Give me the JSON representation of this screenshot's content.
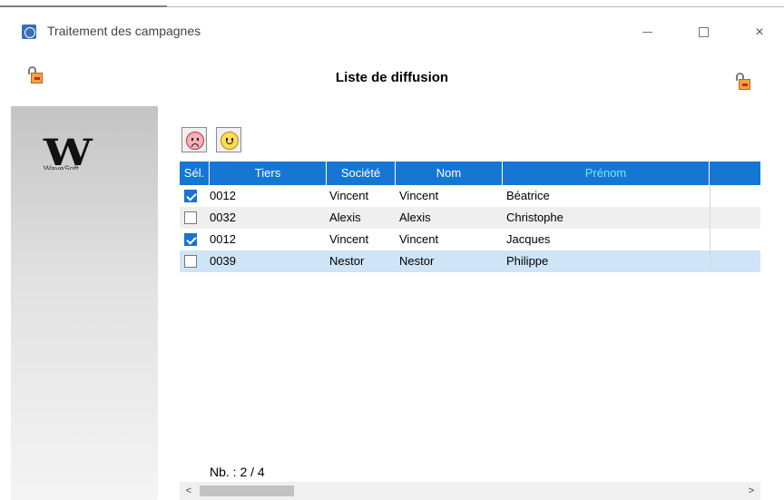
{
  "window": {
    "title": "Traitement des campagnes",
    "buttons": {
      "minimize": "minimize-icon",
      "maximize": "maximize-icon",
      "close": "×"
    }
  },
  "header": {
    "title": "Liste de diffusion",
    "left_icon": "lock-icon",
    "right_icon": "lock-icon"
  },
  "brand": {
    "logo_text": "W",
    "logo_sub": "WaveSoft"
  },
  "filters": [
    {
      "icon": "angry-face-icon"
    },
    {
      "icon": "happy-face-icon"
    }
  ],
  "table": {
    "columns": [
      "Sél.",
      "Tiers",
      "Société",
      "Nom",
      "Prénom",
      ""
    ],
    "rows": [
      {
        "checked": true,
        "tiers": "0012",
        "societe": "Vincent",
        "nom": "Vincent",
        "prenom": "Béatrice"
      },
      {
        "checked": false,
        "tiers": "0032",
        "societe": "Alexis",
        "nom": "Alexis",
        "prenom": "Christophe"
      },
      {
        "checked": true,
        "tiers": "0012",
        "societe": "Vincent",
        "nom": "Vincent",
        "prenom": "Jacques"
      },
      {
        "checked": false,
        "tiers": "0039",
        "societe": "Nestor",
        "nom": "Nestor",
        "prenom": "Philippe"
      }
    ],
    "selected_row": 3
  },
  "footer": {
    "count_label": "Nb. : 2 / 4"
  },
  "scrollbar": {
    "left_arrow": "<",
    "right_arrow": ">"
  },
  "colors": {
    "header_bg": "#1576d4",
    "prenom_header": "#78e8f4",
    "selected_row": "#cfe4f7",
    "checkbox": "#1c72d0"
  }
}
